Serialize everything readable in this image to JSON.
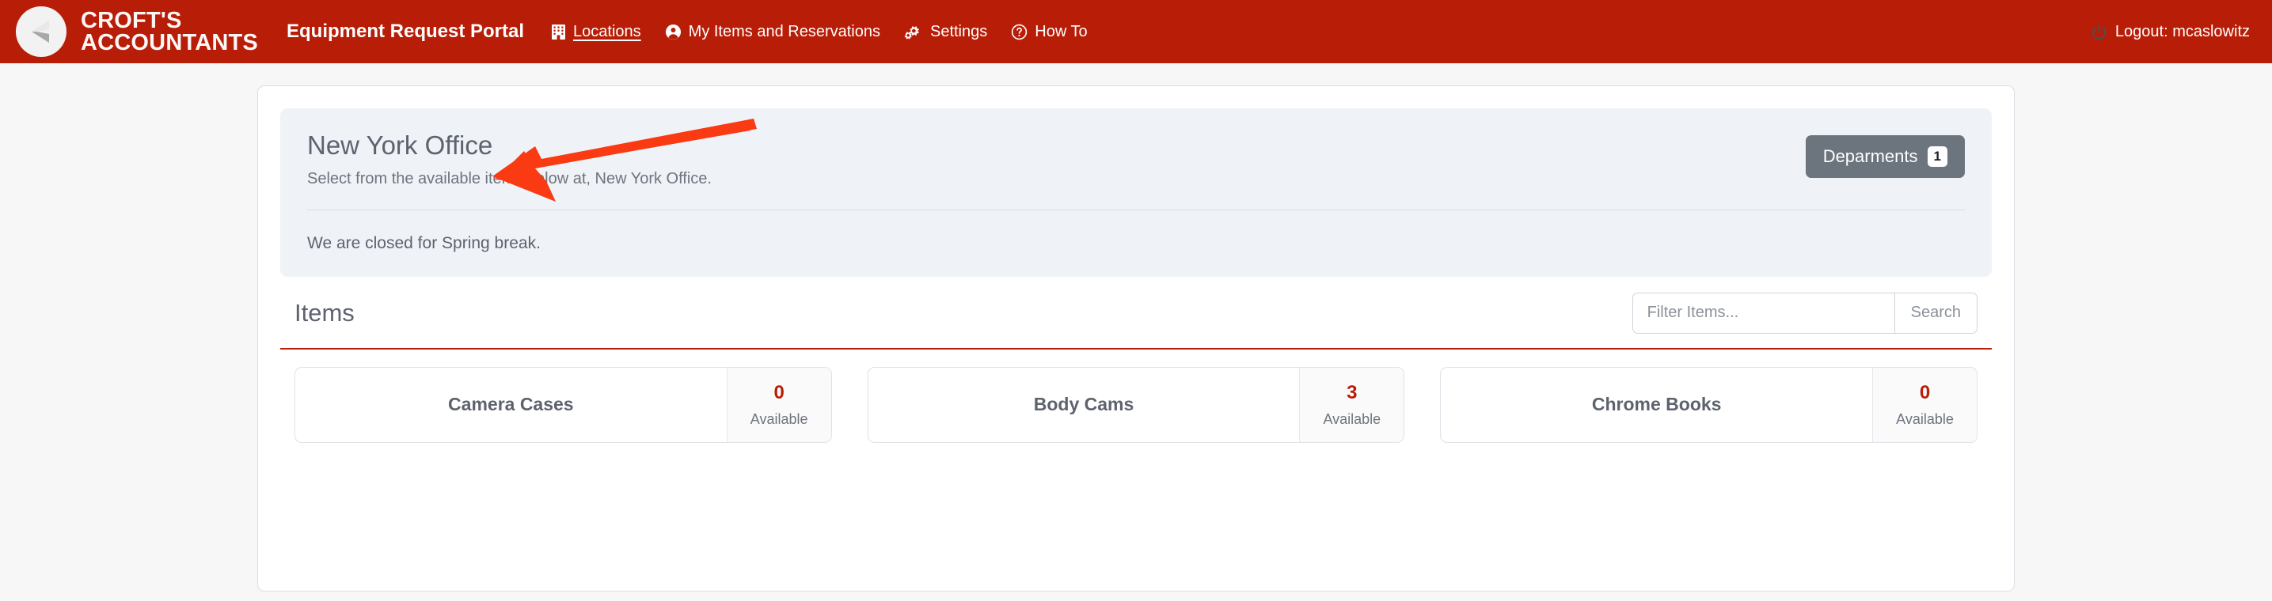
{
  "navbar": {
    "brand_name": "CROFT'S\nACCOUNTANTS",
    "logo_icon": "croft-chevron-logo",
    "app_title": "Equipment Request Portal",
    "links": [
      {
        "label": "Locations",
        "icon": "building-icon",
        "active": true
      },
      {
        "label": "My Items and Reservations",
        "icon": "user-circle-icon",
        "active": false
      },
      {
        "label": "Settings",
        "icon": "cogs-icon",
        "active": false
      },
      {
        "label": "How To",
        "icon": "question-circle-icon",
        "active": false
      }
    ],
    "logout": {
      "label": "Logout: mcaslowitz",
      "icon": "power-icon"
    }
  },
  "location_panel": {
    "title": "New York Office",
    "subtitle": "Select from the available items below at, New York Office.",
    "departments_button": {
      "label": "Deparments",
      "badge": "1"
    },
    "notice": "We are closed for Spring break.",
    "annotation": {
      "type": "arrow",
      "color": "#f93a13",
      "points_to": "closure-notice"
    }
  },
  "items_section": {
    "title": "Items",
    "search": {
      "placeholder": "Filter Items...",
      "value": "",
      "button_label": "Search"
    },
    "available_label": "Available",
    "cards": [
      {
        "name": "Camera Cases",
        "count": "0"
      },
      {
        "name": "Body Cams",
        "count": "3"
      },
      {
        "name": "Chrome Books",
        "count": "0"
      }
    ]
  },
  "colors": {
    "brand_red": "#b81d07",
    "panel_blue_gray": "#eff2f7",
    "annotation_red": "#f93a13",
    "dept_button_gray": "#6c757d"
  }
}
